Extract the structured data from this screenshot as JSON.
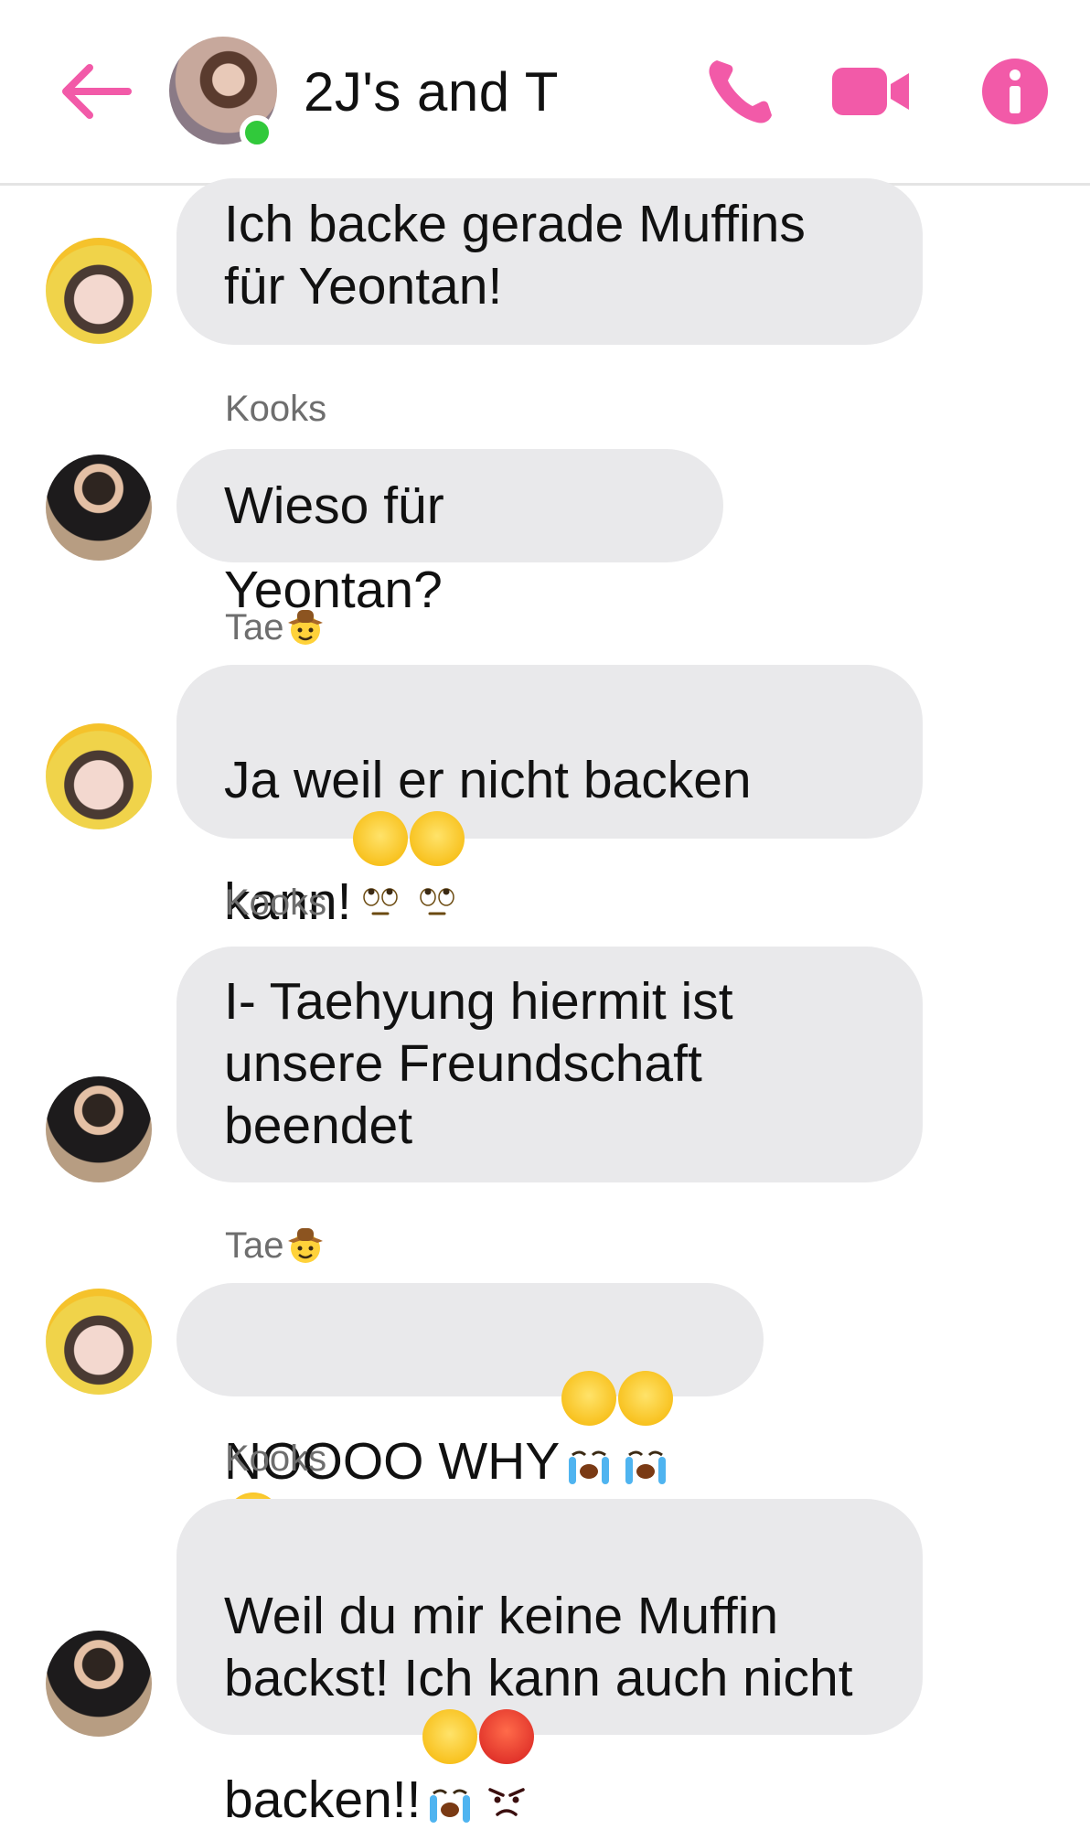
{
  "header": {
    "title": "2J's and T",
    "accent_color": "#f25aa8",
    "online_color": "#31c93b",
    "icons": [
      "arrow-left-icon",
      "phone-icon",
      "video-camera-icon",
      "info-icon"
    ]
  },
  "messages": [
    {
      "sender": "",
      "avatar": "tae",
      "text": "Ich backe gerade Muffins\nfür Yeontan!",
      "emoji": []
    },
    {
      "sender": "Kooks",
      "avatar": "kooks",
      "text": "Wieso für Yeontan?",
      "emoji": []
    },
    {
      "sender": "Tae",
      "sender_emoji": "cowboy",
      "avatar": "tae",
      "text": "Ja weil er nicht backen\nkann!",
      "emoji": [
        "face-with-rolling-eyes",
        "face-with-rolling-eyes"
      ]
    },
    {
      "sender": "Kooks",
      "avatar": "kooks",
      "text": "I- Taehyung hiermit ist\nunsere Freundschaft\nbeendet",
      "emoji": []
    },
    {
      "sender": "Tae",
      "sender_emoji": "cowboy",
      "avatar": "tae",
      "text": "NOOOO WHY",
      "emoji": [
        "loudly-crying-face",
        "loudly-crying-face",
        "loudly-crying-face"
      ]
    },
    {
      "sender": "Kooks",
      "avatar": "kooks",
      "text": "Weil du mir keine Muffin\nbackst! Ich kann auch nicht\nbacken!!",
      "emoji": [
        "loudly-crying-face",
        "pouting-face"
      ]
    }
  ]
}
